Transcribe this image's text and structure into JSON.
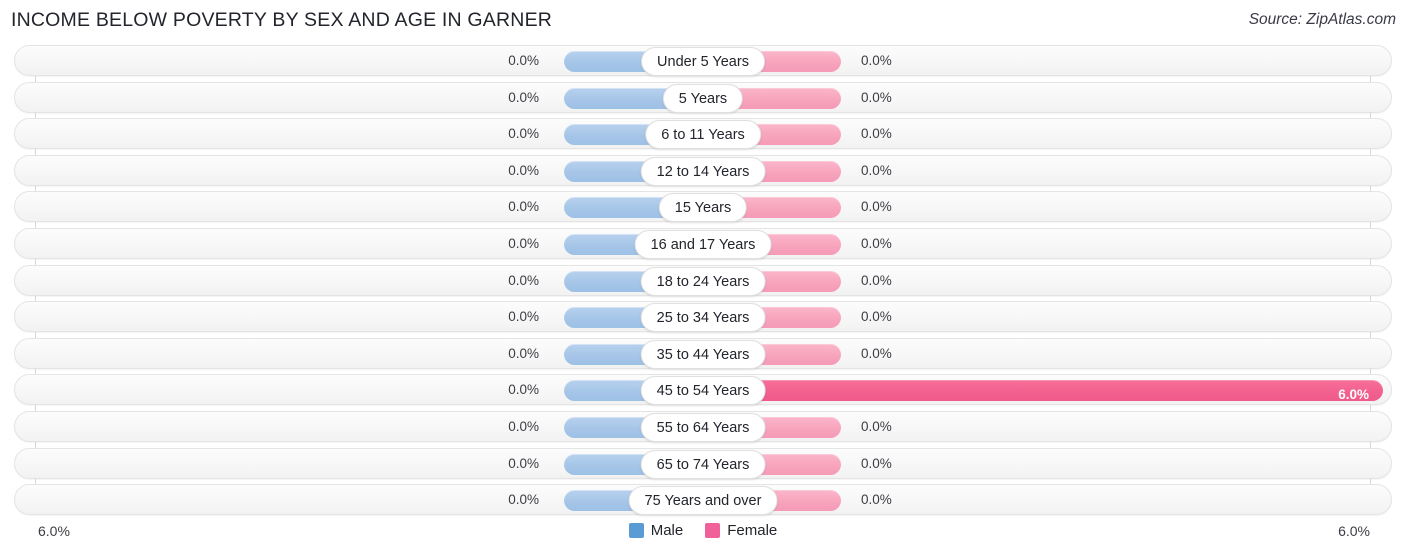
{
  "header": {
    "title": "INCOME BELOW POVERTY BY SEX AND AGE IN GARNER",
    "source": "Source: ZipAtlas.com"
  },
  "legend": {
    "male_label": "Male",
    "female_label": "Female",
    "male_color": "#5b9bd5",
    "female_color": "#f0619a"
  },
  "axis": {
    "left_label": "6.0%",
    "right_label": "6.0%"
  },
  "colors": {
    "male_bar": "#a6c6e8",
    "female_bar": "#f7a4bd",
    "female_bar_high": "#f26190",
    "track": "#f7f7f7",
    "gridline": "#d8d8d8"
  },
  "chart_data": {
    "type": "bar",
    "title": "INCOME BELOW POVERTY BY SEX AND AGE IN GARNER",
    "xlabel": "",
    "ylabel": "",
    "orientation": "horizontal-diverging",
    "axis_max_percent": 6.0,
    "xlim": [
      6.0,
      6.0
    ],
    "grid": true,
    "legend_position": "bottom-center",
    "categories": [
      "Under 5 Years",
      "5 Years",
      "6 to 11 Years",
      "12 to 14 Years",
      "15 Years",
      "16 and 17 Years",
      "18 to 24 Years",
      "25 to 34 Years",
      "35 to 44 Years",
      "45 to 54 Years",
      "55 to 64 Years",
      "65 to 74 Years",
      "75 Years and over"
    ],
    "series": [
      {
        "name": "Male",
        "values": [
          0.0,
          0.0,
          0.0,
          0.0,
          0.0,
          0.0,
          0.0,
          0.0,
          0.0,
          0.0,
          0.0,
          0.0,
          0.0
        ]
      },
      {
        "name": "Female",
        "values": [
          0.0,
          0.0,
          0.0,
          0.0,
          0.0,
          0.0,
          0.0,
          0.0,
          0.0,
          6.0,
          0.0,
          0.0,
          0.0
        ]
      }
    ]
  },
  "rows": [
    {
      "label": "Under 5 Years",
      "male": "0.0%",
      "female": "0.0%",
      "female_pct": 0.0,
      "highlight": false
    },
    {
      "label": "5 Years",
      "male": "0.0%",
      "female": "0.0%",
      "female_pct": 0.0,
      "highlight": false
    },
    {
      "label": "6 to 11 Years",
      "male": "0.0%",
      "female": "0.0%",
      "female_pct": 0.0,
      "highlight": false
    },
    {
      "label": "12 to 14 Years",
      "male": "0.0%",
      "female": "0.0%",
      "female_pct": 0.0,
      "highlight": false
    },
    {
      "label": "15 Years",
      "male": "0.0%",
      "female": "0.0%",
      "female_pct": 0.0,
      "highlight": false
    },
    {
      "label": "16 and 17 Years",
      "male": "0.0%",
      "female": "0.0%",
      "female_pct": 0.0,
      "highlight": false
    },
    {
      "label": "18 to 24 Years",
      "male": "0.0%",
      "female": "0.0%",
      "female_pct": 0.0,
      "highlight": false
    },
    {
      "label": "25 to 34 Years",
      "male": "0.0%",
      "female": "0.0%",
      "female_pct": 0.0,
      "highlight": false
    },
    {
      "label": "35 to 44 Years",
      "male": "0.0%",
      "female": "0.0%",
      "female_pct": 0.0,
      "highlight": false
    },
    {
      "label": "45 to 54 Years",
      "male": "0.0%",
      "female": "6.0%",
      "female_pct": 6.0,
      "highlight": true
    },
    {
      "label": "55 to 64 Years",
      "male": "0.0%",
      "female": "0.0%",
      "female_pct": 0.0,
      "highlight": false
    },
    {
      "label": "65 to 74 Years",
      "male": "0.0%",
      "female": "0.0%",
      "female_pct": 0.0,
      "highlight": false
    },
    {
      "label": "75 Years and over",
      "male": "0.0%",
      "female": "0.0%",
      "female_pct": 0.0,
      "highlight": false
    }
  ]
}
